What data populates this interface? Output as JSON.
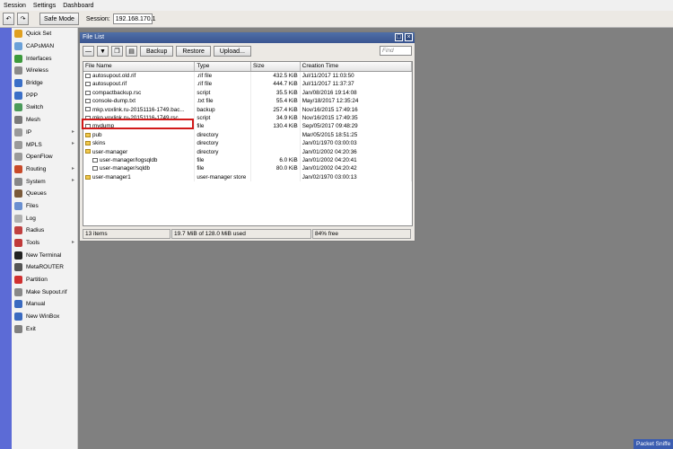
{
  "menu": [
    "Session",
    "Settings",
    "Dashboard"
  ],
  "toolbar": {
    "undo_icon": "undo-icon",
    "redo_icon": "redo-icon",
    "safe_mode": "Safe Mode",
    "session_label": "Session:",
    "session_value": "192.168.170.1"
  },
  "sidebar": [
    {
      "label": "Quick Set",
      "color": "#e0a020",
      "arrow": false
    },
    {
      "label": "CAPsMAN",
      "color": "#6aa0d8",
      "arrow": false
    },
    {
      "label": "Interfaces",
      "color": "#3c9a3c",
      "arrow": false
    },
    {
      "label": "Wireless",
      "color": "#8a8a8a",
      "arrow": false
    },
    {
      "label": "Bridge",
      "color": "#3b6fc7",
      "arrow": false
    },
    {
      "label": "PPP",
      "color": "#3b6fc7",
      "arrow": false
    },
    {
      "label": "Switch",
      "color": "#4a9a5a",
      "arrow": false
    },
    {
      "label": "Mesh",
      "color": "#7a7a7a",
      "arrow": false
    },
    {
      "label": "IP",
      "color": "#9a9a9a",
      "arrow": true
    },
    {
      "label": "MPLS",
      "color": "#9a9a9a",
      "arrow": true
    },
    {
      "label": "OpenFlow",
      "color": "#9a9a9a",
      "arrow": false
    },
    {
      "label": "Routing",
      "color": "#c84a2a",
      "arrow": true
    },
    {
      "label": "System",
      "color": "#888888",
      "arrow": true
    },
    {
      "label": "Queues",
      "color": "#7a5a3a",
      "arrow": false
    },
    {
      "label": "Files",
      "color": "#6a8fd0",
      "arrow": false
    },
    {
      "label": "Log",
      "color": "#b0b0b0",
      "arrow": false
    },
    {
      "label": "Radius",
      "color": "#c04040",
      "arrow": false
    },
    {
      "label": "Tools",
      "color": "#c03a3a",
      "arrow": true
    },
    {
      "label": "New Terminal",
      "color": "#222222",
      "arrow": false
    },
    {
      "label": "MetaROUTER",
      "color": "#555555",
      "arrow": false
    },
    {
      "label": "Partition",
      "color": "#d03030",
      "arrow": false
    },
    {
      "label": "Make Supout.rif",
      "color": "#888888",
      "arrow": false
    },
    {
      "label": "Manual",
      "color": "#3a6ac0",
      "arrow": false
    },
    {
      "label": "New WinBox",
      "color": "#3a6ac0",
      "arrow": false
    },
    {
      "label": "Exit",
      "color": "#808080",
      "arrow": false
    }
  ],
  "window": {
    "title": "File List",
    "buttons": [
      "Backup",
      "Restore",
      "Upload..."
    ],
    "find_placeholder": "Find",
    "columns": [
      "File Name",
      "Type",
      "Size",
      "Creation Time"
    ],
    "rows": [
      {
        "name": "autosupout.old.rif",
        "type": ".rif file",
        "size": "432.5 KiB",
        "time": "Jul/11/2017 11:03:50",
        "dir": false,
        "indent": 0
      },
      {
        "name": "autosupout.rif",
        "type": ".rif file",
        "size": "444.7 KiB",
        "time": "Jul/11/2017 11:37:37",
        "dir": false,
        "indent": 0
      },
      {
        "name": "compactbackup.rsc",
        "type": "script",
        "size": "35.5 KiB",
        "time": "Jan/08/2016 19:14:08",
        "dir": false,
        "indent": 0
      },
      {
        "name": "console-dump.txt",
        "type": ".txt file",
        "size": "55.4 KiB",
        "time": "May/18/2017 12:35:24",
        "dir": false,
        "indent": 0
      },
      {
        "name": "mkp.voxlink.ru-20151116-1749.bac...",
        "type": "backup",
        "size": "257.4 KiB",
        "time": "Nov/16/2015 17:49:16",
        "dir": false,
        "indent": 0
      },
      {
        "name": "mkp.voxlink.ru-20151116-1749.rsc",
        "type": "script",
        "size": "34.9 KiB",
        "time": "Nov/16/2015 17:49:35",
        "dir": false,
        "indent": 0
      },
      {
        "name": "mydump",
        "type": "file",
        "size": "130.4 KiB",
        "time": "Sep/05/2017 09:48:29",
        "dir": false,
        "indent": 0
      },
      {
        "name": "pub",
        "type": "directory",
        "size": "",
        "time": "Mar/05/2015 18:51:25",
        "dir": true,
        "indent": 0
      },
      {
        "name": "skins",
        "type": "directory",
        "size": "",
        "time": "Jan/01/1970 03:00:03",
        "dir": true,
        "indent": 0
      },
      {
        "name": "user-manager",
        "type": "directory",
        "size": "",
        "time": "Jan/01/2002 04:20:36",
        "dir": true,
        "indent": 0
      },
      {
        "name": "user-manager/logsqldb",
        "type": "file",
        "size": "6.0 KiB",
        "time": "Jan/01/2002 04:20:41",
        "dir": false,
        "indent": 1
      },
      {
        "name": "user-manager/sqldb",
        "type": "file",
        "size": "80.0 KiB",
        "time": "Jan/01/2002 04:20:42",
        "dir": false,
        "indent": 1
      },
      {
        "name": "user-manager1",
        "type": "user-manager store",
        "size": "",
        "time": "Jan/02/1970 03:00:13",
        "dir": true,
        "indent": 0
      }
    ],
    "status": [
      "13 items",
      "19.7 MiB of 128.0 MiB used",
      "84% free"
    ]
  },
  "packet_sniffer": "Packet Sniffe"
}
